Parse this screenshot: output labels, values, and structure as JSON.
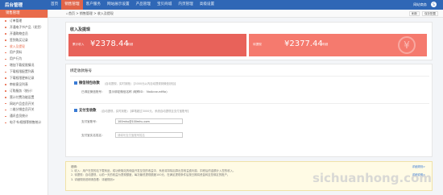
{
  "app": {
    "brand": "后台管理"
  },
  "nav": [
    "首页",
    "销售管理",
    "客户服务",
    "网站展示设置",
    "产品管理",
    "宝贝商城",
    "内页管理",
    "高级设置"
  ],
  "nav_active_index": 1,
  "topright": {
    "user": "网站商务",
    "avatar": "S"
  },
  "sidebar": {
    "header": "销售管理",
    "items": [
      "订单管理",
      "开通电子书产品（发货）",
      "开通购物会员",
      "签到购买记录",
      "收入及提现",
      "用户资料",
      "用户行为",
      "增加下载权限情况",
      "下载权限配置列表",
      "下载权限更新记录",
      "审核意见列表",
      "订购服务（统计）",
      "营计付费功能设置",
      "网站产品会员开关",
      "二维分销会员开关",
      "通讯会员统计",
      "电子书/视频等销售统计"
    ],
    "active_index": 4
  },
  "breadcrumb": {
    "home": "首页",
    "sep1": ">",
    "l1": "销售管理",
    "sep2": ">",
    "l2": "收入及提现",
    "refresh": "刷新",
    "save": "保存配置"
  },
  "income": {
    "title": "收入及提现",
    "card1": {
      "label": "累计收入",
      "amount": "¥2378.44",
      "desc": "明细"
    },
    "card2": {
      "label": "待提现",
      "amount": "¥2377.44",
      "desc": "明细"
    }
  },
  "account": {
    "title": "绑定收款账号",
    "wechat": {
      "title": "微信钱包收款",
      "hint": "(自动提现，实时到账)  【3000元以内自动提现到微信钱包】",
      "label": "已绑定微信账号：",
      "value": "显示绑定微信名称 (昵称ID： NoAccountNo)"
    },
    "alipay": {
      "title": "支付宝收款",
      "hint": "(自动提现，实时到账)  【单笔超过3000元，系统自动提现至支付宝账号】",
      "account_label": "支付宝账号：",
      "account_value": "100mhu@100mhu.com",
      "name_label": "支付宝实名姓名：",
      "name_placeholder": "请填写支付宝账号姓名"
    }
  },
  "notes": {
    "title": "说明：",
    "line1": "1. 收入：用户在您的站下载商品，成功获取站的佣金开发至您的收益中，系统将扣除后算出您收益费利息，扣税后的金额计入您的收入。",
    "line2": "2. 待提现：自动提现，以前一天的收益为提现额度，每次最低提现额度100元，在满足提现条件后按日期将资金转至您绑定的账户。",
    "line3": "3. 详细规则说明请查看：详细规则>",
    "link1": "详细规则>",
    "link2": "详细说明>"
  },
  "watermark": "sichuanhong.com"
}
